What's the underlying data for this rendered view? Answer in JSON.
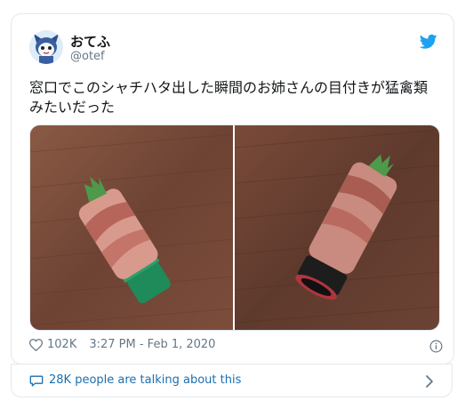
{
  "tweet": {
    "display_name": "おてふ",
    "handle": "@otef",
    "text": "窓口でこのシャチハタ出した瞬間のお姉さんの目付きが猛禽類みたいだった",
    "likes": "102K",
    "timestamp": "3:27 PM - Feb 1, 2020",
    "icons": {
      "logo": "twitter-bird-icon",
      "like": "heart-icon",
      "info": "info-icon",
      "conversation": "speech-bubble-icon",
      "chevron": "chevron-right-icon"
    },
    "accent_color": "#1da1f2"
  },
  "conversation": {
    "label": "28K people are talking about this"
  }
}
